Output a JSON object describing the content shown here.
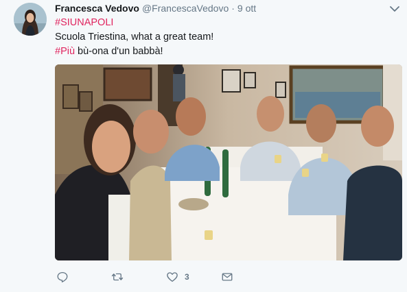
{
  "tweet": {
    "user": {
      "display_name": "Francesca Vedovo",
      "handle": "@FrancescaVedovo",
      "separator": "·",
      "timestamp": "9 ott"
    },
    "text": {
      "line1_hashtag": "#SIUNAPOLI",
      "line2": "Scuola Triestina, what a great team!",
      "line3_hashtag": "#Più",
      "line3_rest": " bù-ona d'un babbà!"
    },
    "media": {
      "description_icon": "photo"
    },
    "actions": {
      "reply_icon": "reply-icon",
      "retweet_icon": "retweet-icon",
      "like_icon": "heart-icon",
      "like_count": "3",
      "dm_icon": "envelope-icon"
    }
  },
  "colors": {
    "hashtag": "#e0245e",
    "muted": "#657786",
    "background": "#f5f8fa"
  }
}
